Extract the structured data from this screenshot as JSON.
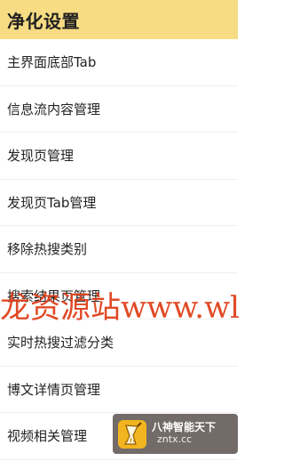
{
  "header": {
    "title": "净化设置"
  },
  "list": {
    "items": [
      {
        "label": "主界面底部Tab"
      },
      {
        "label": "信息流内容管理"
      },
      {
        "label": "发现页管理"
      },
      {
        "label": "发现页Tab管理"
      },
      {
        "label": "移除热搜类别"
      },
      {
        "label": "搜索结果页管理"
      },
      {
        "label": "实时热搜过滤分类"
      },
      {
        "label": "博文详情页管理"
      },
      {
        "label": "视频相关管理"
      }
    ]
  },
  "watermark": {
    "text": "龙资源站www.wl",
    "color": "#e0401a"
  },
  "badge": {
    "title": "八神智能天下",
    "url": "zntx.cc",
    "logo_icon": "broom-logo-icon"
  },
  "colors": {
    "header_bg": "#f7dc84",
    "divider": "#efefef"
  }
}
